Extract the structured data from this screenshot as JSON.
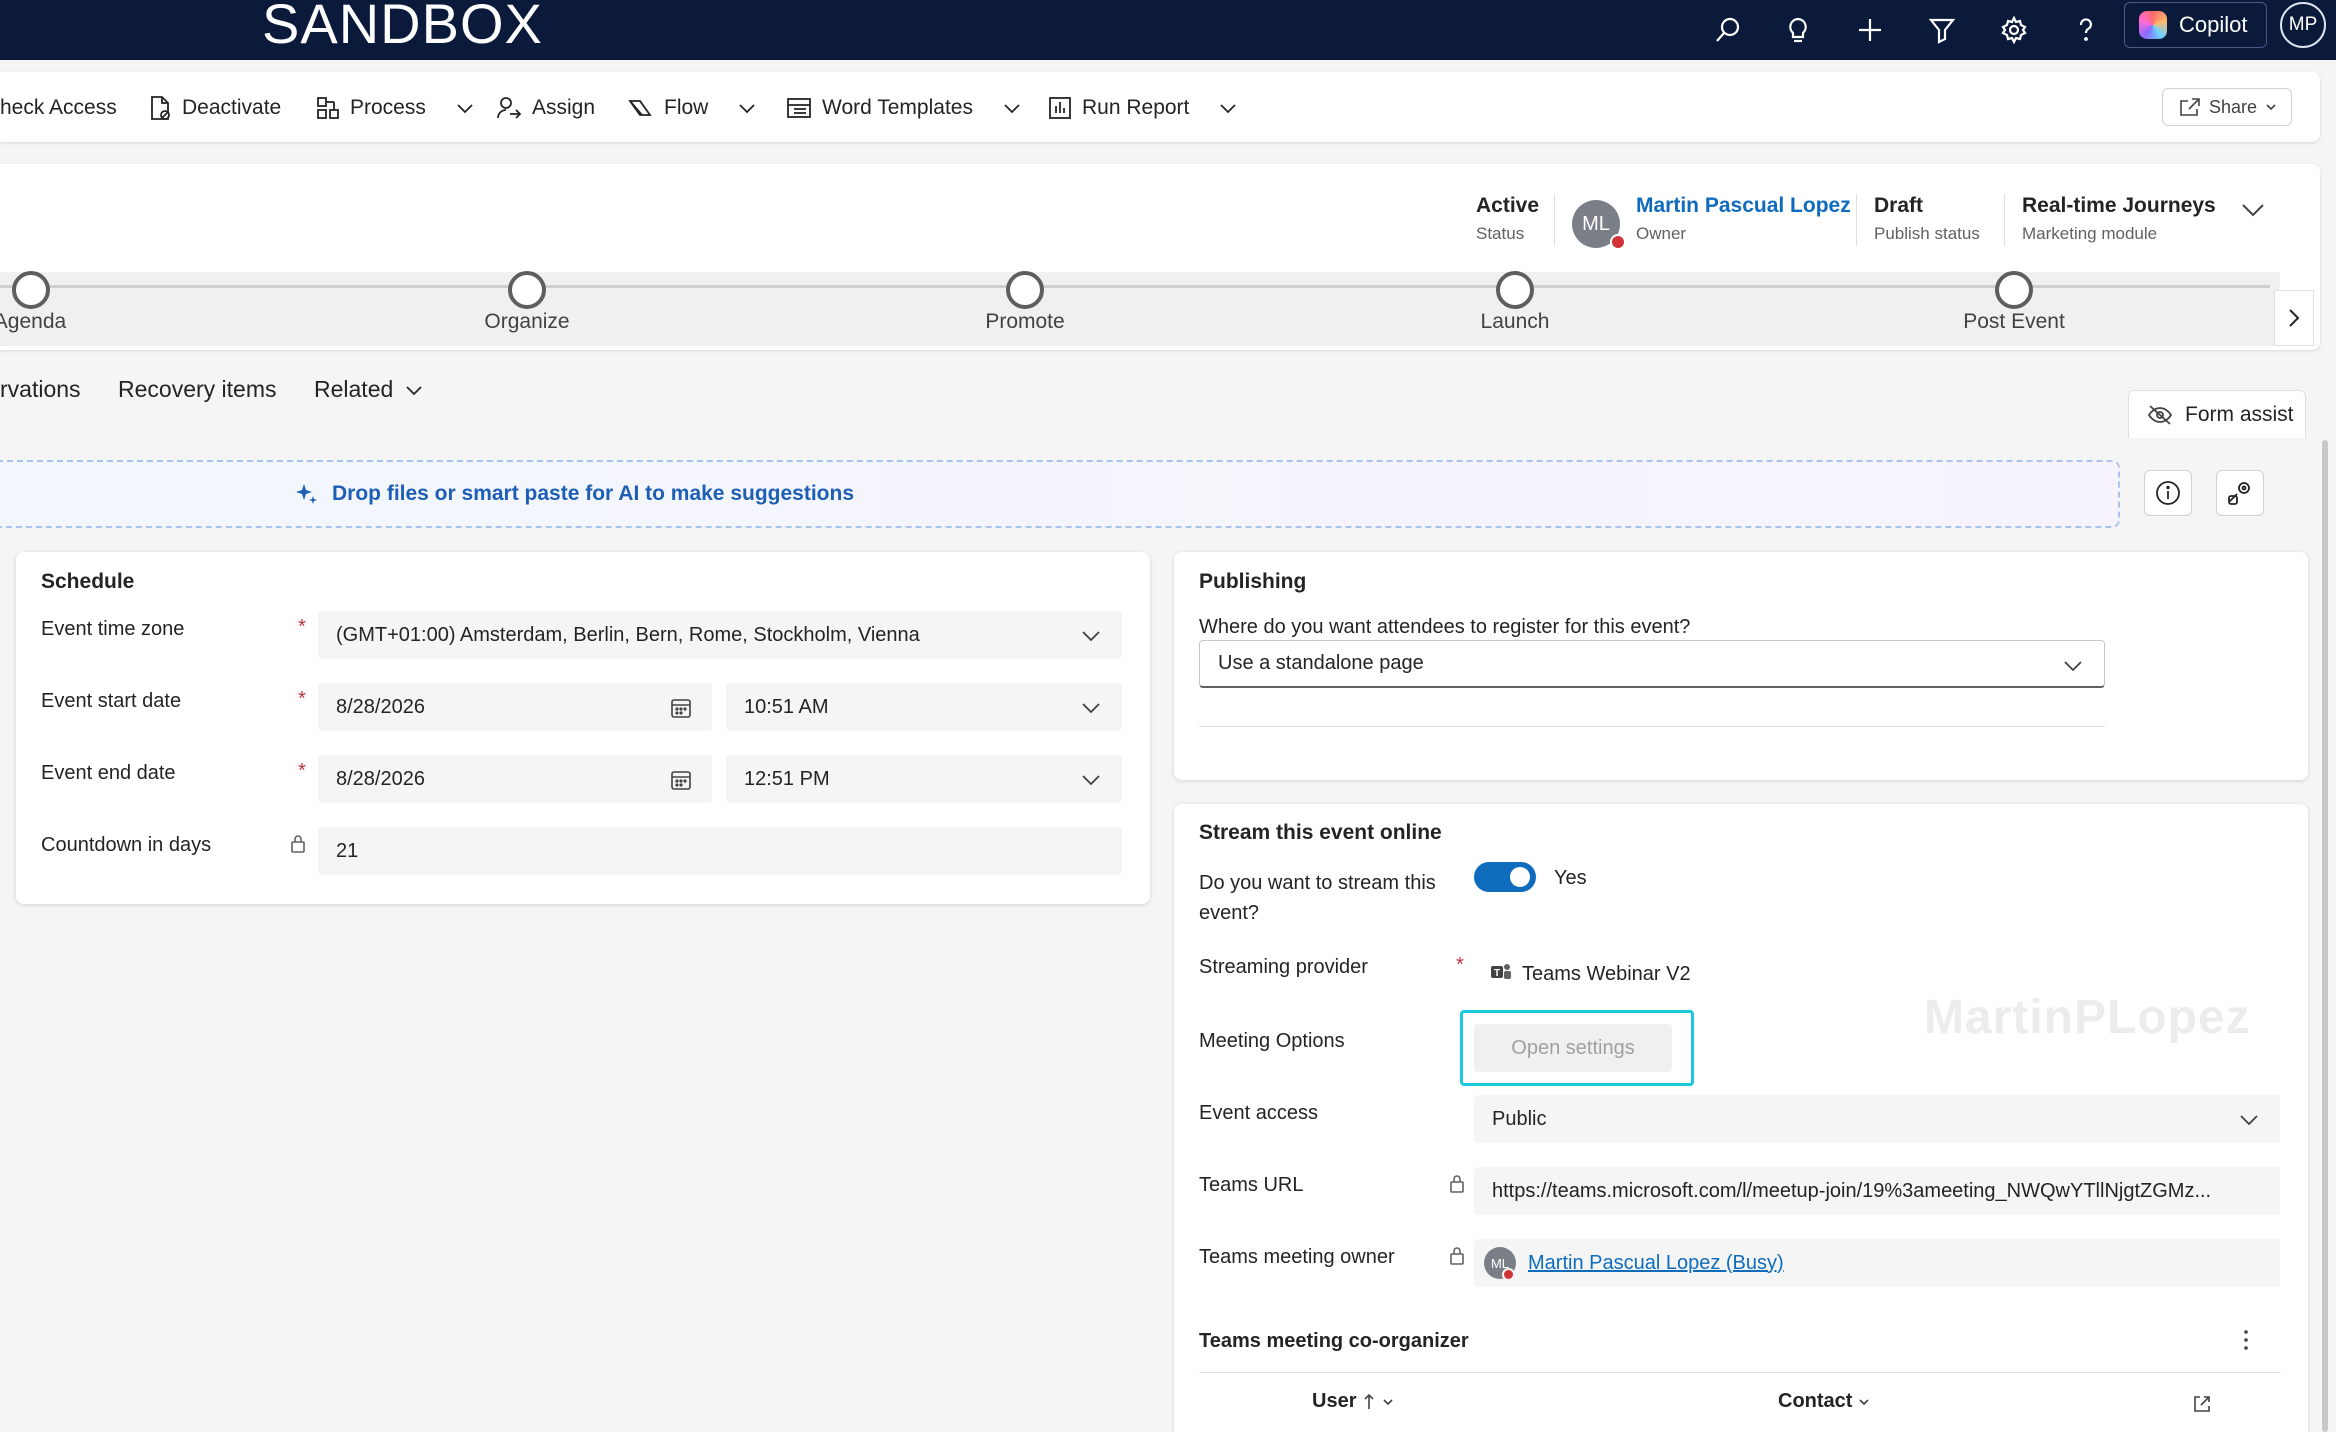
{
  "topbar": {
    "brand": "SANDBOX",
    "copilot_label": "Copilot",
    "user_initials": "MP",
    "icons": [
      "search-icon",
      "lightbulb-icon",
      "plus-icon",
      "filter-icon",
      "gear-icon",
      "help-icon"
    ]
  },
  "commands": {
    "check_access": "heck Access",
    "deactivate": "Deactivate",
    "process": "Process",
    "assign": "Assign",
    "flow": "Flow",
    "word_templates": "Word Templates",
    "run_report": "Run Report",
    "share": "Share"
  },
  "header": {
    "status_value": "Active",
    "status_label": "Status",
    "owner_initials": "ML",
    "owner_name": "Martin Pascual Lopez",
    "owner_label": "Owner",
    "publish_value": "Draft",
    "publish_label": "Publish status",
    "module_value": "Real-time Journeys",
    "module_label": "Marketing module"
  },
  "stages": [
    "Agenda",
    "Organize",
    "Promote",
    "Launch",
    "Post Event"
  ],
  "tabs": {
    "reservations": "rvations",
    "recovery": "Recovery items",
    "related": "Related",
    "form_assist": "Form assist"
  },
  "dropzone": {
    "text": "Drop files or smart paste for AI to make suggestions"
  },
  "schedule": {
    "title": "Schedule",
    "timezone_label": "Event time zone",
    "timezone_value": "(GMT+01:00) Amsterdam, Berlin, Bern, Rome, Stockholm, Vienna",
    "start_label": "Event start date",
    "start_date": "8/28/2026",
    "start_time": "10:51 AM",
    "end_label": "Event end date",
    "end_date": "8/28/2026",
    "end_time": "12:51 PM",
    "countdown_label": "Countdown in days",
    "countdown_value": "21"
  },
  "publishing": {
    "title": "Publishing",
    "question": "Where do you want attendees to register for this event?",
    "value": "Use a standalone page"
  },
  "stream": {
    "title": "Stream this event online",
    "question_line1": "Do you want to stream this",
    "question_line2": "event?",
    "toggle_value": "Yes",
    "provider_label": "Streaming provider",
    "provider_value": "Teams Webinar V2",
    "meeting_options_label": "Meeting Options",
    "open_settings": "Open settings",
    "access_label": "Event access",
    "access_value": "Public",
    "url_label": "Teams URL",
    "url_value": "https://teams.microsoft.com/l/meetup-join/19%3ameeting_NWQwYTllNjgtZGMz...",
    "owner_label": "Teams meeting owner",
    "owner_initials": "ML",
    "owner_value": "Martin Pascual Lopez (Busy)",
    "coorganizer_title": "Teams meeting co-organizer",
    "col_user": "User",
    "col_contact": "Contact"
  },
  "watermark": "MartinPLopez",
  "colors": {
    "topbar": "#0b1a3a",
    "accent": "#0f6cbd",
    "highlight": "#1ec8dc",
    "required": "#c4314b"
  }
}
